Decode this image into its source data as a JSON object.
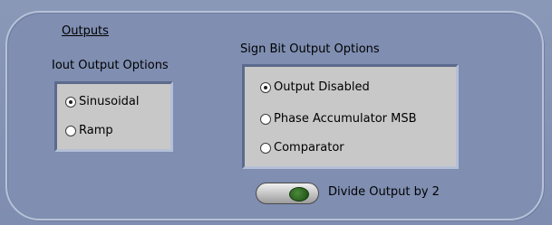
{
  "outputs": {
    "title": "Outputs"
  },
  "iout_group": {
    "label": "Iout Output Options",
    "options": [
      {
        "label": "Sinusoidal",
        "selected": true
      },
      {
        "label": "Ramp",
        "selected": false
      }
    ]
  },
  "sign_group": {
    "label": "Sign Bit Output Options",
    "options": [
      {
        "label": "Output Disabled",
        "selected": true
      },
      {
        "label": "Phase Accumulator MSB",
        "selected": false
      },
      {
        "label": "Comparator",
        "selected": false
      }
    ]
  },
  "divide_toggle": {
    "label": "Divide Output by 2",
    "state": "on"
  },
  "colors": {
    "background": "#7f8fb1",
    "option_box": "#c8c8c8",
    "toggle_led": "#2f6a1e"
  }
}
